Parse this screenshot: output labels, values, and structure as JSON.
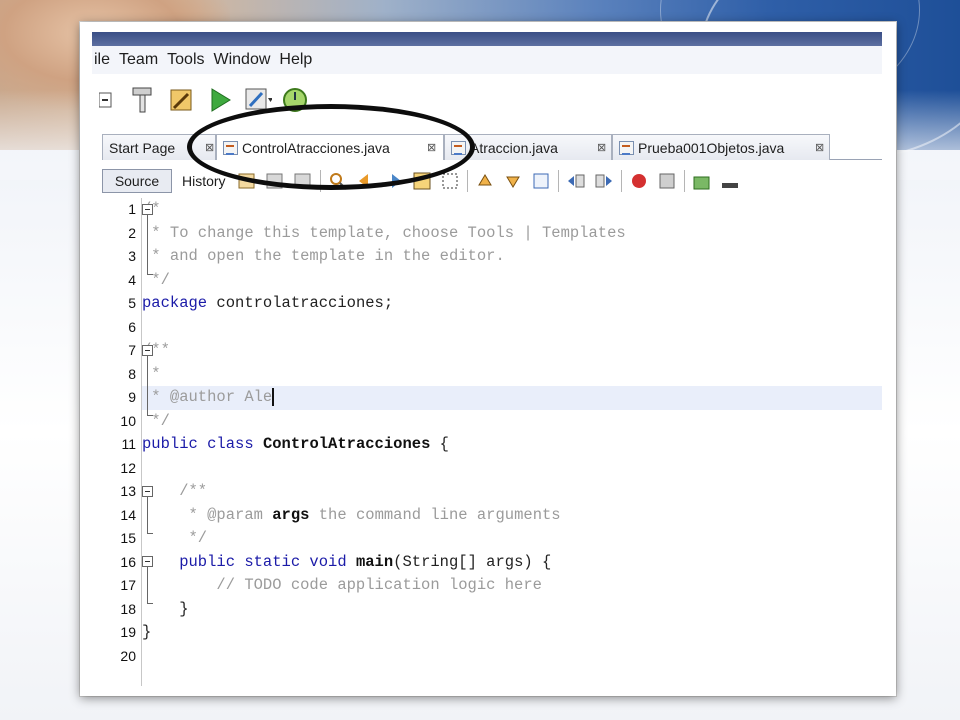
{
  "menu": [
    "ile",
    "Team",
    "Tools",
    "Window",
    "Help"
  ],
  "tabs": [
    {
      "label": "Start Page"
    },
    {
      "label": "ControlAtracciones.java"
    },
    {
      "label": "Atraccion.java"
    },
    {
      "label": "Prueba001Objetos.java"
    }
  ],
  "editor_toolbar": {
    "source": "Source",
    "history": "History"
  },
  "lines": [
    {
      "n": "1"
    },
    {
      "n": "2"
    },
    {
      "n": "3"
    },
    {
      "n": "4"
    },
    {
      "n": "5"
    },
    {
      "n": "6"
    },
    {
      "n": "7"
    },
    {
      "n": "8"
    },
    {
      "n": "9"
    },
    {
      "n": "10"
    },
    {
      "n": "11"
    },
    {
      "n": "12"
    },
    {
      "n": "13"
    },
    {
      "n": "14"
    },
    {
      "n": "15"
    },
    {
      "n": "16"
    },
    {
      "n": "17"
    },
    {
      "n": "18"
    },
    {
      "n": "19"
    },
    {
      "n": "20"
    }
  ],
  "code": {
    "l1": "/*",
    "l2": " * To change this template, choose Tools | Templates",
    "l3": " * and open the template in the editor.",
    "l4": " */",
    "l5_kw": "package",
    "l5_rest": " controlatracciones;",
    "l7": "/**",
    "l8": " *",
    "l9": " * @author Ale",
    "l10": " */",
    "l11_kw": "public class",
    "l11_name": "ControlAtracciones",
    "l11_rest": " {",
    "l13": "    /**",
    "l14_a": "     * @param",
    "l14_b": "args",
    "l14_c": " the command line arguments",
    "l15": "     */",
    "l16_kw": "    public static void",
    "l16_name": "main",
    "l16_rest": "(String[] args) {",
    "l17": "        // TODO code application logic here",
    "l18": "    }",
    "l19": "}"
  }
}
